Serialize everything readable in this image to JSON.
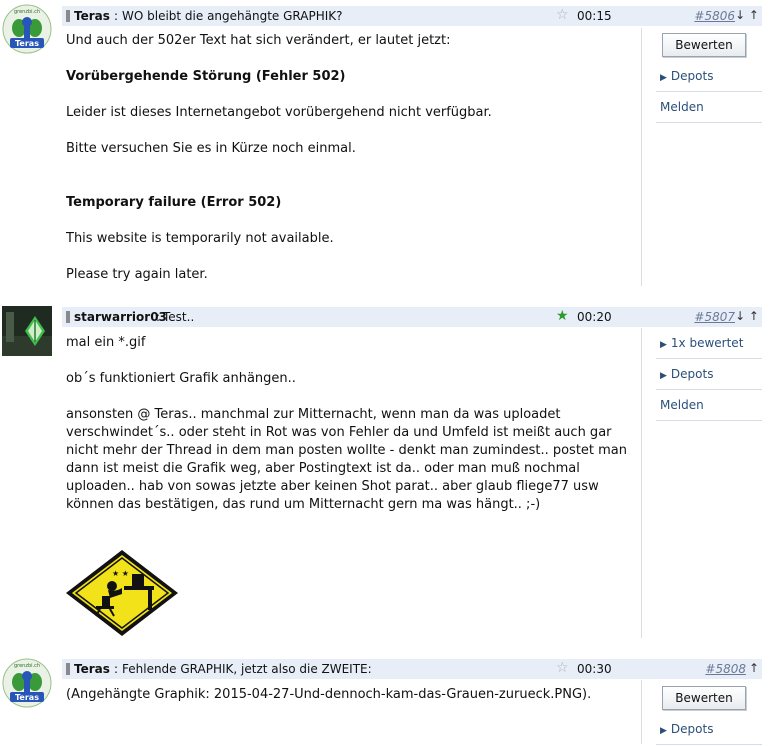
{
  "posts": [
    {
      "author": "Teras",
      "separator": ":",
      "subject": "WO bleibt die angehängte GRAPHIK?",
      "time": "00:15",
      "number": "#5806",
      "arrows": "↓ ↑",
      "star": "☆",
      "avatar_text": "Teras",
      "avatar_top": "grenzbi.ch",
      "body": {
        "line1": "Und auch der 502er Text hat sich verändert, er lautet jetzt:",
        "heading1": "Vorübergehende Störung (Fehler 502)",
        "line2": "Leider ist dieses Internetangebot vorübergehend nicht verfügbar.",
        "line3": "Bitte versuchen Sie es in Kürze noch einmal.",
        "heading2": "Temporary failure (Error 502)",
        "line4": "This website is temporarily not available.",
        "line5": "Please try again later."
      },
      "side": {
        "button": "Bewerten",
        "depots": "Depots",
        "melden": "Melden"
      }
    },
    {
      "author": "starwarrior03",
      "separator": ":",
      "subject": "Test..",
      "time": "00:20",
      "number": "#5807",
      "arrows": "↓ ↑",
      "star": "★",
      "body": {
        "line1": "mal ein *.gif",
        "line2": "ob´s funktioniert Grafik anhängen..",
        "para": "ansonsten @ Teras.. manchmal zur Mitternacht, wenn man da was uploadet verschwindet´s.. oder steht in Rot was von Fehler da und Umfeld ist meißt auch gar nicht mehr der Thread in dem man posten wollte - denkt man zumindest.. postet man dann ist meist die Grafik weg, aber Postingtext ist da.. oder man muß nochmal uploaden.. hab von sowas jetzte aber keinen Shot parat.. aber glaub fliege77 usw können das bestätigen, das rund um Mitternacht gern ma was hängt.. ;-)"
      },
      "side": {
        "rated": "1x bewertet",
        "depots": "Depots",
        "melden": "Melden"
      }
    },
    {
      "author": "Teras",
      "separator": ":",
      "subject": "Fehlende GRAPHIK, jetzt also die ZWEITE:",
      "time": "00:30",
      "number": "#5808",
      "arrows": "↑",
      "star": "☆",
      "avatar_text": "Teras",
      "avatar_top": "grenzbi.ch",
      "body": {
        "line1": "(Angehängte Graphik: 2015-04-27-Und-dennoch-kam-das-Grauen-zurueck.PNG)."
      },
      "side": {
        "button": "Bewerten",
        "depots": "Depots"
      }
    }
  ],
  "colors": {
    "header_bg": "#e8eef8",
    "link": "#2b4f7a",
    "number": "#6b7a99",
    "star_active": "#2a9a2a"
  }
}
